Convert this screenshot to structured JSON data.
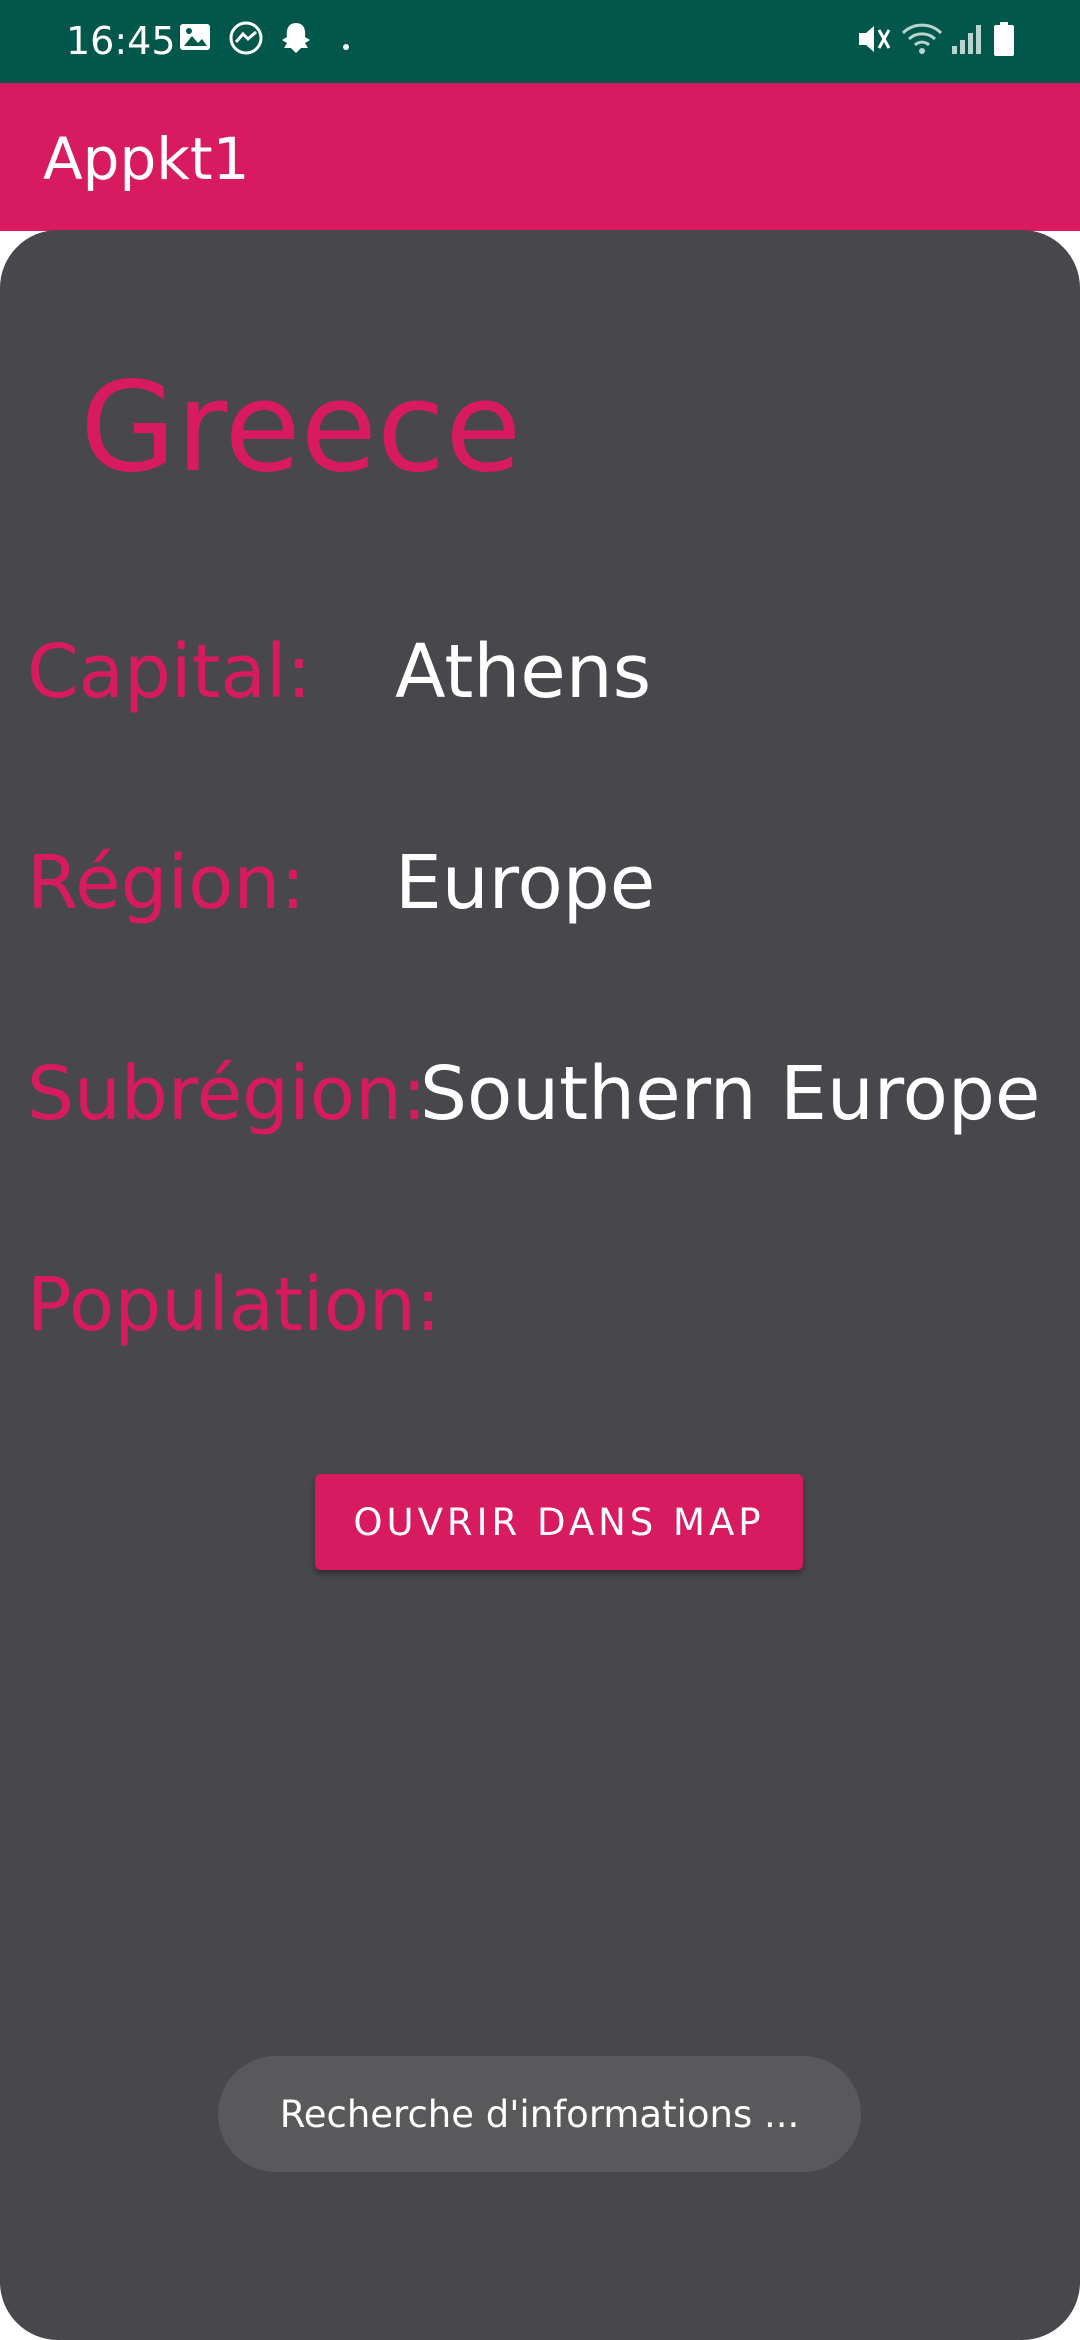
{
  "status_bar": {
    "time": "16:45",
    "left_icons": [
      "image-icon",
      "messenger-icon",
      "snapchat-icon",
      "dot-icon"
    ],
    "right_icons": [
      "mute-icon",
      "wifi-icon",
      "signal-icon",
      "battery-icon"
    ]
  },
  "app_bar": {
    "title": "Appkt1"
  },
  "country": {
    "name": "Greece",
    "fields": [
      {
        "label": "Capital:",
        "value": "Athens"
      },
      {
        "label": "Région:",
        "value": "Europe"
      },
      {
        "label": "Subrégion:",
        "value": "Southern Europe"
      },
      {
        "label": "Population:",
        "value": ""
      }
    ]
  },
  "actions": {
    "open_map_label": "OUVRIR DANS MAP"
  },
  "toast": {
    "message": "Recherche d'informations ..."
  },
  "colors": {
    "status_bar": "#02574b",
    "accent": "#d81b60",
    "card_background": "#48474c",
    "toast_background": "#59585a"
  }
}
